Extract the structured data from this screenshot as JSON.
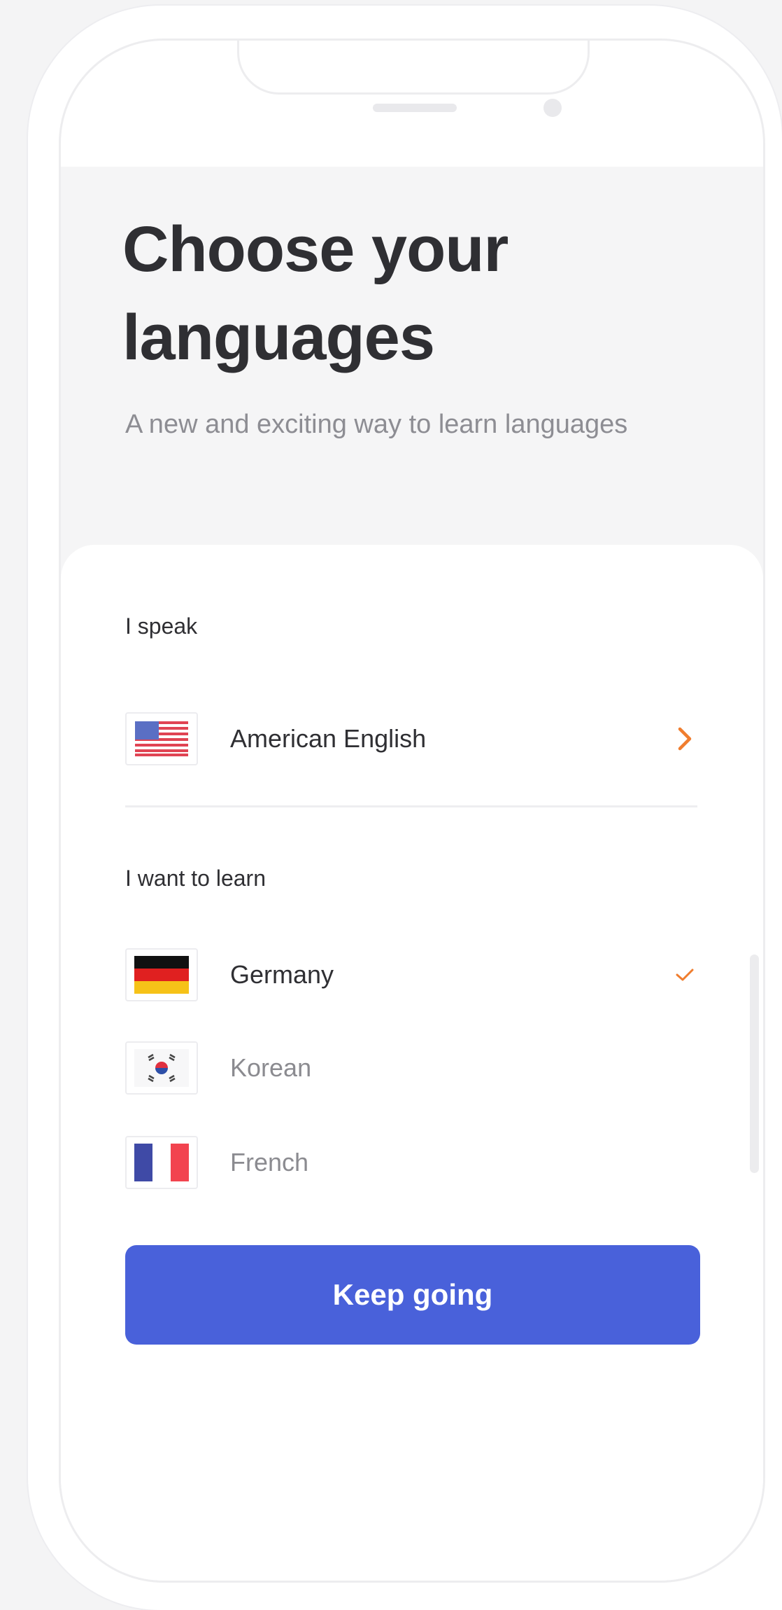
{
  "header": {
    "title_line1": "Choose your",
    "title_line2": "languages",
    "subtitle": "A new and exciting way to learn languages"
  },
  "speak": {
    "section_label": "I speak",
    "selected": {
      "label": "American English",
      "flag": "us-flag",
      "trailing_icon": "chevron-right-icon"
    }
  },
  "learn": {
    "section_label": "I want to learn",
    "items": [
      {
        "label": "Germany",
        "flag": "germany-flag",
        "selected": true
      },
      {
        "label": "Korean",
        "flag": "korea-flag",
        "selected": false
      },
      {
        "label": "French",
        "flag": "france-flag",
        "selected": false
      }
    ]
  },
  "button": {
    "label": "Keep going"
  },
  "colors": {
    "accent": "#4961da",
    "orange": "#f07d2e",
    "title": "#2f2f33",
    "muted": "#8b8b90"
  }
}
